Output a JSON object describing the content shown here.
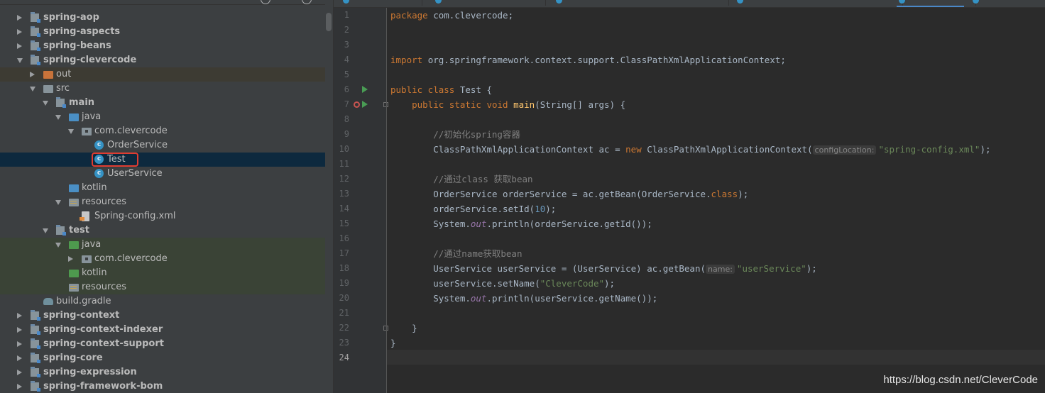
{
  "project": {
    "tree": [
      {
        "label": "spring-aop",
        "level": 1,
        "arrow": "right",
        "icon": "module",
        "bold": true
      },
      {
        "label": "spring-aspects",
        "level": 1,
        "arrow": "right",
        "icon": "module",
        "bold": true
      },
      {
        "label": "spring-beans",
        "level": 1,
        "arrow": "right",
        "icon": "module",
        "bold": true
      },
      {
        "label": "spring-clevercode",
        "level": 1,
        "arrow": "down",
        "icon": "module",
        "bold": true
      },
      {
        "label": "out",
        "level": 2,
        "arrow": "right",
        "icon": "folder-orange",
        "bg": "excl"
      },
      {
        "label": "src",
        "level": 2,
        "arrow": "down",
        "icon": "folder-grey"
      },
      {
        "label": "main",
        "level": 3,
        "arrow": "down",
        "icon": "module",
        "bold": true
      },
      {
        "label": "java",
        "level": 4,
        "arrow": "down",
        "icon": "folder-blue"
      },
      {
        "label": "com.clevercode",
        "level": 5,
        "arrow": "down",
        "icon": "package"
      },
      {
        "label": "OrderService",
        "level": 6,
        "arrow": "none",
        "icon": "class"
      },
      {
        "label": "Test",
        "level": 6,
        "arrow": "none",
        "icon": "class",
        "selected": true
      },
      {
        "label": "UserService",
        "level": 6,
        "arrow": "none",
        "icon": "class"
      },
      {
        "label": "kotlin",
        "level": 4,
        "arrow": "none",
        "icon": "folder-blue"
      },
      {
        "label": "resources",
        "level": 4,
        "arrow": "down",
        "icon": "folder-res"
      },
      {
        "label": "Spring-config.xml",
        "level": 5,
        "arrow": "none",
        "icon": "xml"
      },
      {
        "label": "test",
        "level": 3,
        "arrow": "down",
        "icon": "module",
        "bold": true
      },
      {
        "label": "java",
        "level": 4,
        "arrow": "down",
        "icon": "folder-green",
        "bg": "test"
      },
      {
        "label": "com.clevercode",
        "level": 5,
        "arrow": "right",
        "icon": "package",
        "bg": "test"
      },
      {
        "label": "kotlin",
        "level": 4,
        "arrow": "none",
        "icon": "folder-green",
        "bg": "test"
      },
      {
        "label": "resources",
        "level": 4,
        "arrow": "none",
        "icon": "folder-res",
        "bg": "test"
      },
      {
        "label": "build.gradle",
        "level": 2,
        "arrow": "none",
        "icon": "gradle"
      },
      {
        "label": "spring-context",
        "level": 1,
        "arrow": "right",
        "icon": "module",
        "bold": true
      },
      {
        "label": "spring-context-indexer",
        "level": 1,
        "arrow": "right",
        "icon": "module",
        "bold": true
      },
      {
        "label": "spring-context-support",
        "level": 1,
        "arrow": "right",
        "icon": "module",
        "bold": true
      },
      {
        "label": "spring-core",
        "level": 1,
        "arrow": "right",
        "icon": "module",
        "bold": true
      },
      {
        "label": "spring-expression",
        "level": 1,
        "arrow": "right",
        "icon": "module",
        "bold": true
      },
      {
        "label": "spring-framework-bom",
        "level": 1,
        "arrow": "right",
        "icon": "module",
        "bold": true
      }
    ]
  },
  "editor": {
    "current_line": 24,
    "lines": [
      {
        "n": "1",
        "t": [
          [
            "kw",
            "package "
          ],
          [
            "",
            "com.clevercode;"
          ]
        ]
      },
      {
        "n": "2",
        "t": []
      },
      {
        "n": "3",
        "t": []
      },
      {
        "n": "4",
        "t": [
          [
            "kw",
            "import "
          ],
          [
            "",
            "org.springframework.context.support.ClassPathXmlApplicationContext;"
          ]
        ]
      },
      {
        "n": "5",
        "t": []
      },
      {
        "n": "6",
        "t": [
          [
            "kw",
            "public class "
          ],
          [
            "",
            "Test {"
          ]
        ],
        "run": true
      },
      {
        "n": "7",
        "t": [
          [
            "",
            "    "
          ],
          [
            "kw",
            "public static void "
          ],
          [
            "fn",
            "main"
          ],
          [
            "",
            "(String[] args) {"
          ]
        ],
        "run": true,
        "debug": true,
        "fold": true
      },
      {
        "n": "8",
        "t": []
      },
      {
        "n": "9",
        "t": [
          [
            "",
            "        "
          ],
          [
            "cm",
            "//初始化spring容器"
          ]
        ]
      },
      {
        "n": "10",
        "t": [
          [
            "",
            "        ClassPathXmlApplicationContext ac = "
          ],
          [
            "kw",
            "new "
          ],
          [
            "",
            "ClassPathXmlApplicationContext("
          ],
          [
            "hint",
            "configLocation:"
          ],
          [
            "str",
            "\"spring-config.xml\""
          ],
          [
            "",
            ");"
          ]
        ]
      },
      {
        "n": "11",
        "t": []
      },
      {
        "n": "12",
        "t": [
          [
            "",
            "        "
          ],
          [
            "cm",
            "//通过class 获取bean"
          ]
        ]
      },
      {
        "n": "13",
        "t": [
          [
            "",
            "        OrderService orderService = ac.getBean(OrderService."
          ],
          [
            "kw",
            "class"
          ],
          [
            "",
            ");"
          ]
        ]
      },
      {
        "n": "14",
        "t": [
          [
            "",
            "        orderService.setId("
          ],
          [
            "num",
            "10"
          ],
          [
            "",
            ");"
          ]
        ]
      },
      {
        "n": "15",
        "t": [
          [
            "",
            "        System."
          ],
          [
            "sf",
            "out"
          ],
          [
            "",
            ".println(orderService.getId());"
          ]
        ]
      },
      {
        "n": "16",
        "t": []
      },
      {
        "n": "17",
        "t": [
          [
            "",
            "        "
          ],
          [
            "cm",
            "//通过name获取bean"
          ]
        ]
      },
      {
        "n": "18",
        "t": [
          [
            "",
            "        UserService userService = (UserService) ac.getBean("
          ],
          [
            "hint",
            "name:"
          ],
          [
            "str",
            "\"userService\""
          ],
          [
            "",
            ");"
          ]
        ]
      },
      {
        "n": "19",
        "t": [
          [
            "",
            "        userService.setName("
          ],
          [
            "str",
            "\"CleverCode\""
          ],
          [
            "",
            ");"
          ]
        ]
      },
      {
        "n": "20",
        "t": [
          [
            "",
            "        System."
          ],
          [
            "sf",
            "out"
          ],
          [
            "",
            ".println(userService.getName());"
          ]
        ]
      },
      {
        "n": "21",
        "t": []
      },
      {
        "n": "22",
        "t": [
          [
            "",
            "    }"
          ]
        ],
        "fold": true
      },
      {
        "n": "23",
        "t": [
          [
            "",
            "}"
          ]
        ]
      },
      {
        "n": "24",
        "t": []
      }
    ]
  },
  "watermark": "https://blog.csdn.net/CleverCode",
  "colors": {
    "keyword": "#cc7832",
    "string": "#6a8759",
    "comment": "#808080",
    "number": "#6897bb",
    "method": "#ffc66d",
    "selection": "#0d293e",
    "highlight_box": "#e03c31"
  }
}
